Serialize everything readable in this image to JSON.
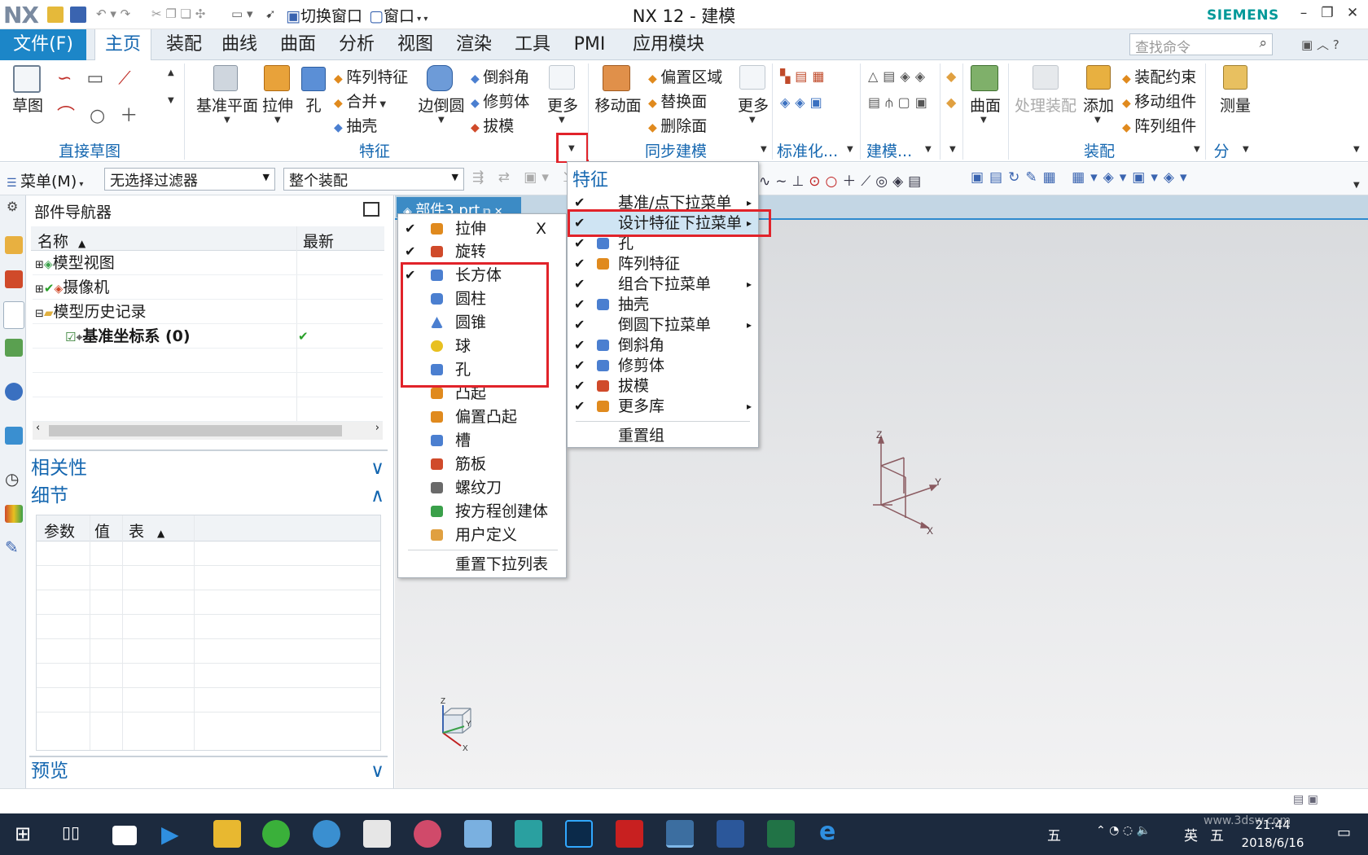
{
  "titlebar": {
    "logo": "NX",
    "switch_window": "切换窗口",
    "window": "窗口",
    "title": "NX 12 - 建模",
    "brand": "SIEMENS"
  },
  "menubar": {
    "file": "文件(F)",
    "tabs": [
      "主页",
      "装配",
      "曲线",
      "曲面",
      "分析",
      "视图",
      "渲染",
      "工具",
      "PMI",
      "应用模块"
    ],
    "search_placeholder": "查找命令"
  },
  "ribbon": {
    "sketch": "草图",
    "direct_sketch": "直接草图",
    "datum_plane": "基准平面",
    "extrude": "拉伸",
    "hole": "孔",
    "pattern_feature": "阵列特征",
    "unite": "合并",
    "shell": "抽壳",
    "edge_blend": "边倒圆",
    "chamfer": "倒斜角",
    "trim_body": "修剪体",
    "draft": "拔模",
    "more1": "更多",
    "feature": "特征",
    "move_face": "移动面",
    "offset_region": "偏置区域",
    "replace_face": "替换面",
    "delete_face": "删除面",
    "more2": "更多",
    "sync_modeling": "同步建模",
    "standardize": "标准化...",
    "modeling": "建模...",
    "surface": "曲面",
    "process_assembly": "处理装配",
    "add": "添加",
    "assembly_constraints": "装配约束",
    "move_component": "移动组件",
    "pattern_component": "阵列组件",
    "assembly": "装配",
    "measure": "测量",
    "analysis_short": "分"
  },
  "toolbar2": {
    "menu": "菜单(M)",
    "filter": "无选择过滤器",
    "scope": "整个装配"
  },
  "navigator": {
    "title": "部件导航器",
    "col_name": "名称",
    "col_latest": "最新",
    "rows": [
      "模型视图",
      "摄像机",
      "模型历史记录",
      "基准坐标系 (0)"
    ],
    "dependencies": "相关性",
    "details": "细节",
    "detail_cols": [
      "参数",
      "值",
      "表"
    ],
    "preview": "预览"
  },
  "doc_tab": "部件3.prt",
  "feature_menu": {
    "title": "特征",
    "items": [
      {
        "label": "基准/点下拉菜单",
        "checked": true,
        "sub": true
      },
      {
        "label": "设计特征下拉菜单",
        "checked": true,
        "sub": true
      },
      {
        "label": "孔",
        "checked": true,
        "sub": false
      },
      {
        "label": "阵列特征",
        "checked": true,
        "sub": false
      },
      {
        "label": "组合下拉菜单",
        "checked": true,
        "sub": true
      },
      {
        "label": "抽壳",
        "checked": true,
        "sub": false
      },
      {
        "label": "倒圆下拉菜单",
        "checked": true,
        "sub": true
      },
      {
        "label": "倒斜角",
        "checked": true,
        "sub": false
      },
      {
        "label": "修剪体",
        "checked": true,
        "sub": false
      },
      {
        "label": "拔模",
        "checked": true,
        "sub": false
      },
      {
        "label": "更多库",
        "checked": true,
        "sub": true
      }
    ],
    "reset": "重置组"
  },
  "design_menu": {
    "items": [
      {
        "label": "拉伸",
        "checked": true,
        "color": "#e08a1e"
      },
      {
        "label": "旋转",
        "checked": true,
        "color": "#d04a2a"
      },
      {
        "label": "长方体",
        "checked": true,
        "color": "#4b7fd0"
      },
      {
        "label": "圆柱",
        "checked": false,
        "color": "#4b7fd0"
      },
      {
        "label": "圆锥",
        "checked": false,
        "color": "#4b7fd0"
      },
      {
        "label": "球",
        "checked": false,
        "color": "#e8c020"
      },
      {
        "label": "孔",
        "checked": false,
        "color": "#4b7fd0"
      },
      {
        "label": "凸起",
        "checked": false,
        "color": "#e08a1e"
      },
      {
        "label": "偏置凸起",
        "checked": false,
        "color": "#e08a1e"
      },
      {
        "label": "槽",
        "checked": false,
        "color": "#4b7fd0"
      },
      {
        "label": "筋板",
        "checked": false,
        "color": "#d04a2a"
      },
      {
        "label": "螺纹刀",
        "checked": false,
        "color": "#6a6a6a"
      },
      {
        "label": "按方程创建体",
        "checked": false,
        "color": "#3aa04a"
      },
      {
        "label": "用户定义",
        "checked": false,
        "color": "#e0a040"
      }
    ],
    "close": "X",
    "reset": "重置下拉列表"
  },
  "axes": {
    "z": "Z",
    "y": "Y",
    "x": "X"
  },
  "taskbar": {
    "ime": "五",
    "lang": "英",
    "time": "21:44",
    "date": "2018/6/16",
    "watermark": "www.3dsw.com"
  },
  "colors": {
    "accent": "#1c86c8",
    "highlight": "#e1232a",
    "taskbar": "#1c2a3e"
  }
}
